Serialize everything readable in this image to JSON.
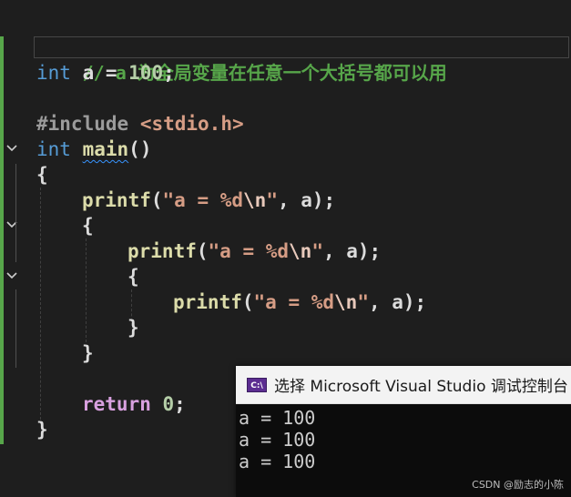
{
  "editor": {
    "line_comment": "// a 为全局变量在任意一个大括号都可以用",
    "global_decl": {
      "type_kw": "int",
      "rest": " a = ",
      "value": "100",
      "end": ";"
    },
    "include": {
      "directive": "#include",
      "header": "<stdio.h>"
    },
    "main_sig": {
      "type_kw": "int",
      "space": " ",
      "name": "main",
      "parens": "()"
    },
    "open_brace": "{",
    "close_brace": "}",
    "printf_call": {
      "fn": "printf",
      "open": "(",
      "str_start": "\"a = %d",
      "escape": "\\n",
      "str_end": "\"",
      "args": ", a);"
    },
    "return_stmt": {
      "kw": "return",
      "space": " ",
      "value": "0",
      "end": ";"
    }
  },
  "console": {
    "title": "选择 Microsoft Visual Studio 调试控制台",
    "icon_text": "C:\\",
    "output": [
      "a = 100",
      "a = 100",
      "a = 100"
    ]
  },
  "watermark": "CSDN @励志的小陈",
  "icons": [
    "collapse-chevron-icon",
    "console-app-icon"
  ],
  "colors": {
    "background": "#1e1e1e",
    "keyword": "#569cd6",
    "control_keyword": "#d8a0df",
    "function": "#dcdcaa",
    "string": "#d69d85",
    "number": "#b5cea8",
    "comment": "#57a64a",
    "change_bar": "#57a64a"
  }
}
